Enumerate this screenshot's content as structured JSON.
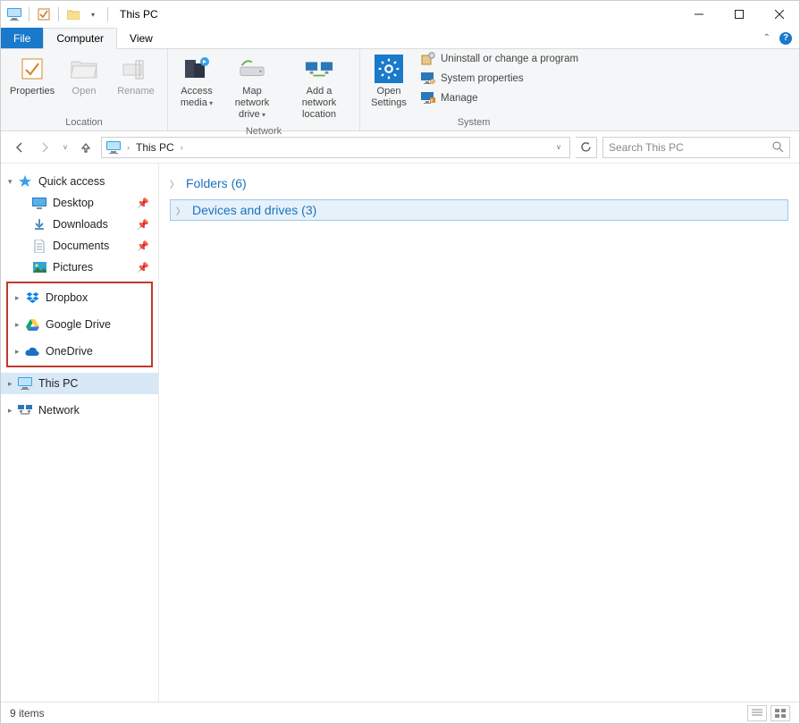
{
  "window": {
    "title": "This PC"
  },
  "ribbon": {
    "tabs": {
      "file": "File",
      "computer": "Computer",
      "view": "View"
    },
    "location": {
      "group_label": "Location",
      "properties": "Properties",
      "open": "Open",
      "rename": "Rename"
    },
    "network": {
      "group_label": "Network",
      "access_media": "Access media",
      "map_drive": "Map network drive",
      "add_location": "Add a network location"
    },
    "system": {
      "group_label": "System",
      "open_settings": "Open Settings",
      "uninstall": "Uninstall or change a program",
      "sys_props": "System properties",
      "manage": "Manage"
    }
  },
  "address": {
    "current": "This PC",
    "sep": "›"
  },
  "search": {
    "placeholder": "Search This PC"
  },
  "nav": {
    "quick_access": "Quick access",
    "desktop": "Desktop",
    "downloads": "Downloads",
    "documents": "Documents",
    "pictures": "Pictures",
    "dropbox": "Dropbox",
    "google_drive": "Google Drive",
    "onedrive": "OneDrive",
    "this_pc": "This PC",
    "network": "Network"
  },
  "groups": {
    "folders": "Folders (6)",
    "devices": "Devices and drives (3)"
  },
  "status": {
    "items": "9 items"
  }
}
